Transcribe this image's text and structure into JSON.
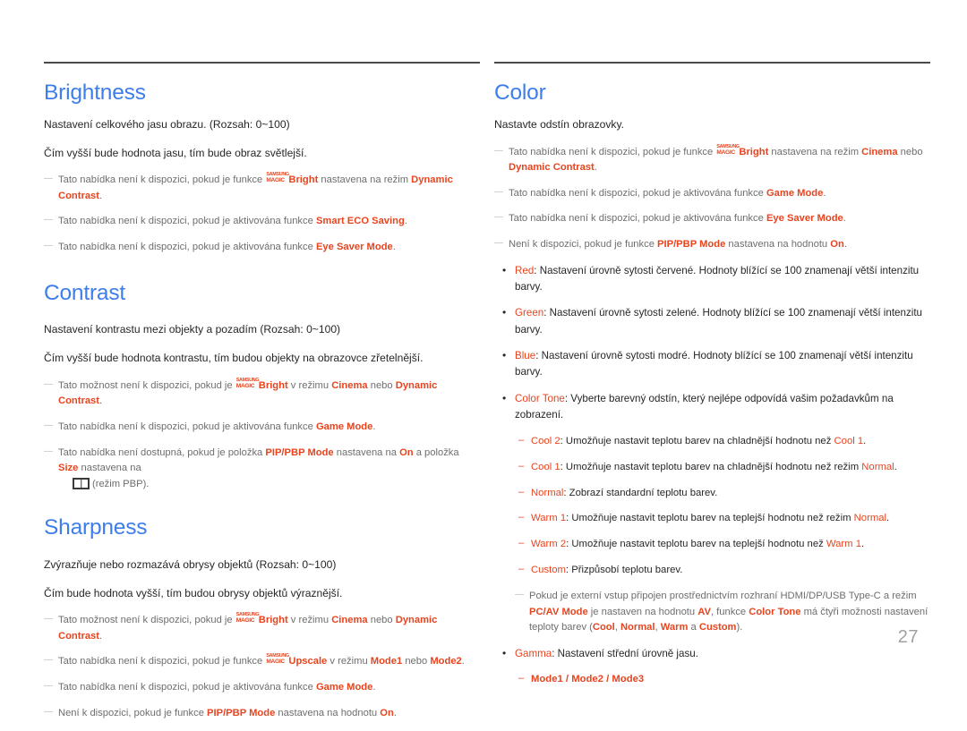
{
  "document": {
    "page_number": "27",
    "colors": {
      "heading_blue": "#3d7eea",
      "highlight_orange": "#e8441f",
      "note_gray": "#6e6e6e",
      "rule_gray": "#4a4a4a",
      "page_number_gray": "#a0a0a0"
    }
  },
  "left_column": {
    "sections": [
      {
        "title": "Brightness",
        "body": [
          "Nastavení celkového jasu obrazu. (Rozsah: 0~100)",
          "Čím vyšší bude hodnota jasu, tím bude obraz světlejší."
        ],
        "notes": {
          "n1_a": "Tato nabídka není k dispozici, pokud je funkce ",
          "n1_logo_line1": "SAMSUNG",
          "n1_logo_line2": "MAGIC",
          "n1_b": "Bright",
          "n1_c": " nastavena na režim ",
          "n1_d": "Dynamic Contrast",
          "n1_e": ".",
          "n2_a": "Tato nabídka není k dispozici, pokud je aktivována funkce ",
          "n2_b": "Smart ECO Saving",
          "n2_c": ".",
          "n3_a": "Tato nabídka není k dispozici, pokud je aktivována funkce ",
          "n3_b": "Eye Saver Mode",
          "n3_c": "."
        }
      },
      {
        "title": "Contrast",
        "body": [
          "Nastavení kontrastu mezi objekty a pozadím (Rozsah: 0~100)",
          "Čím vyšší bude hodnota kontrastu, tím budou objekty na obrazovce zřetelnější."
        ],
        "notes": {
          "n1_a": "Tato možnost není k dispozici, pokud je ",
          "n1_logo_line1": "SAMSUNG",
          "n1_logo_line2": "MAGIC",
          "n1_b": "Bright",
          "n1_c": " v režimu ",
          "n1_d": "Cinema",
          "n1_e": " nebo ",
          "n1_f": "Dynamic Contrast",
          "n1_g": ".",
          "n2_a": "Tato nabídka není k dispozici, pokud je aktivována funkce ",
          "n2_b": "Game Mode",
          "n2_c": ".",
          "n3_a": "Tato nabídka není dostupná, pokud je položka ",
          "n3_b": "PIP/PBP Mode",
          "n3_c": " nastavena na ",
          "n3_d": "On",
          "n3_e": " a položka ",
          "n3_f": "Size",
          "n3_g": " nastavena na",
          "n3_h": "(režim PBP)."
        }
      },
      {
        "title": "Sharpness",
        "body": [
          "Zvýrazňuje nebo rozmazává obrysy objektů (Rozsah: 0~100)",
          "Čím bude hodnota vyšší, tím budou obrysy objektů výraznější."
        ],
        "notes": {
          "n1_a": "Tato možnost není k dispozici, pokud je ",
          "n1_logo_line1": "SAMSUNG",
          "n1_logo_line2": "MAGIC",
          "n1_b": "Bright",
          "n1_c": " v režimu ",
          "n1_d": "Cinema",
          "n1_e": " nebo ",
          "n1_f": "Dynamic Contrast",
          "n1_g": ".",
          "n2_a": "Tato nabídka není k dispozici, pokud je funkce ",
          "n2_logo_line1": "SAMSUNG",
          "n2_logo_line2": "MAGIC",
          "n2_b": "Upscale",
          "n2_c": " v režimu ",
          "n2_d": "Mode1",
          "n2_e": " nebo ",
          "n2_f": "Mode2",
          "n2_g": ".",
          "n3_a": "Tato nabídka není k dispozici, pokud je aktivována funkce ",
          "n3_b": "Game Mode",
          "n3_c": ".",
          "n4_a": "Není k dispozici, pokud je funkce ",
          "n4_b": "PIP/PBP Mode",
          "n4_c": " nastavena na hodnotu ",
          "n4_d": "On",
          "n4_e": "."
        }
      }
    ]
  },
  "right_column": {
    "section": {
      "title": "Color",
      "body": [
        "Nastavte odstín obrazovky."
      ],
      "notes": {
        "n1_a": "Tato nabídka není k dispozici, pokud je funkce ",
        "n1_logo_line1": "SAMSUNG",
        "n1_logo_line2": "MAGIC",
        "n1_b": "Bright",
        "n1_c": " nastavena na režim ",
        "n1_d": "Cinema",
        "n1_e": " nebo ",
        "n1_f": "Dynamic Contrast",
        "n1_g": ".",
        "n2_a": "Tato nabídka není k dispozici, pokud je aktivována funkce ",
        "n2_b": "Game Mode",
        "n2_c": ".",
        "n3_a": "Tato nabídka není k dispozici, pokud je aktivována funkce ",
        "n3_b": "Eye Saver Mode",
        "n3_c": ".",
        "n4_a": "Není k dispozici, pokud je funkce ",
        "n4_b": "PIP/PBP Mode",
        "n4_c": " nastavena na hodnotu ",
        "n4_d": "On",
        "n4_e": "."
      },
      "bullets": {
        "b1_term": "Red",
        "b1_text": ": Nastavení úrovně sytosti červené. Hodnoty blížící se 100 znamenají větší intenzitu barvy.",
        "b2_term": "Green",
        "b2_text": ": Nastavení úrovně sytosti zelené. Hodnoty blížící se 100 znamenají větší intenzitu barvy.",
        "b3_term": "Blue",
        "b3_text": ": Nastavení úrovně sytosti modré. Hodnoty blížící se 100 znamenají větší intenzitu barvy.",
        "b4_term": "Color Tone",
        "b4_text": ": Vyberte barevný odstín, který nejlépe odpovídá vašim požadavkům na zobrazení.",
        "b5_term": "Gamma",
        "b5_text": ": Nastavení střední úrovně jasu."
      },
      "color_tone_options": {
        "o1_term": "Cool 2",
        "o1_a": ": Umožňuje nastavit teplotu barev na chladnější hodnotu než ",
        "o1_ref": "Cool 1",
        "o1_b": ".",
        "o2_term": "Cool 1",
        "o2_a": ": Umožňuje nastavit teplotu barev na chladnější hodnotu než režim ",
        "o2_ref": "Normal",
        "o2_b": ".",
        "o3_term": "Normal",
        "o3_a": ": Zobrazí standardní teplotu barev.",
        "o4_term": "Warm 1",
        "o4_a": ": Umožňuje nastavit teplotu barev na teplejší hodnotu než režim ",
        "o4_ref": "Normal",
        "o4_b": ".",
        "o5_term": "Warm 2",
        "o5_a": ": Umožňuje nastavit teplotu barev na teplejší hodnotu než ",
        "o5_ref": "Warm 1",
        "o5_b": ".",
        "o6_term": "Custom",
        "o6_a": ": Přizpůsobí teplotu barev."
      },
      "external_input_note": {
        "a": "Pokud je externí vstup připojen prostřednictvím rozhraní HDMI/DP/USB Type-C a režim ",
        "b": "PC/AV Mode",
        "c": " je nastaven na hodnotu ",
        "d": "AV",
        "e": ", funkce ",
        "f": "Color Tone",
        "g": " má čtyři možnosti nastavení teploty barev (",
        "h": "Cool",
        "i": ", ",
        "j": "Normal",
        "k": ", ",
        "l": "Warm",
        "m": " a ",
        "n": "Custom",
        "o": ")."
      },
      "gamma_modes": "Mode1 / Mode2 / Mode3"
    }
  }
}
